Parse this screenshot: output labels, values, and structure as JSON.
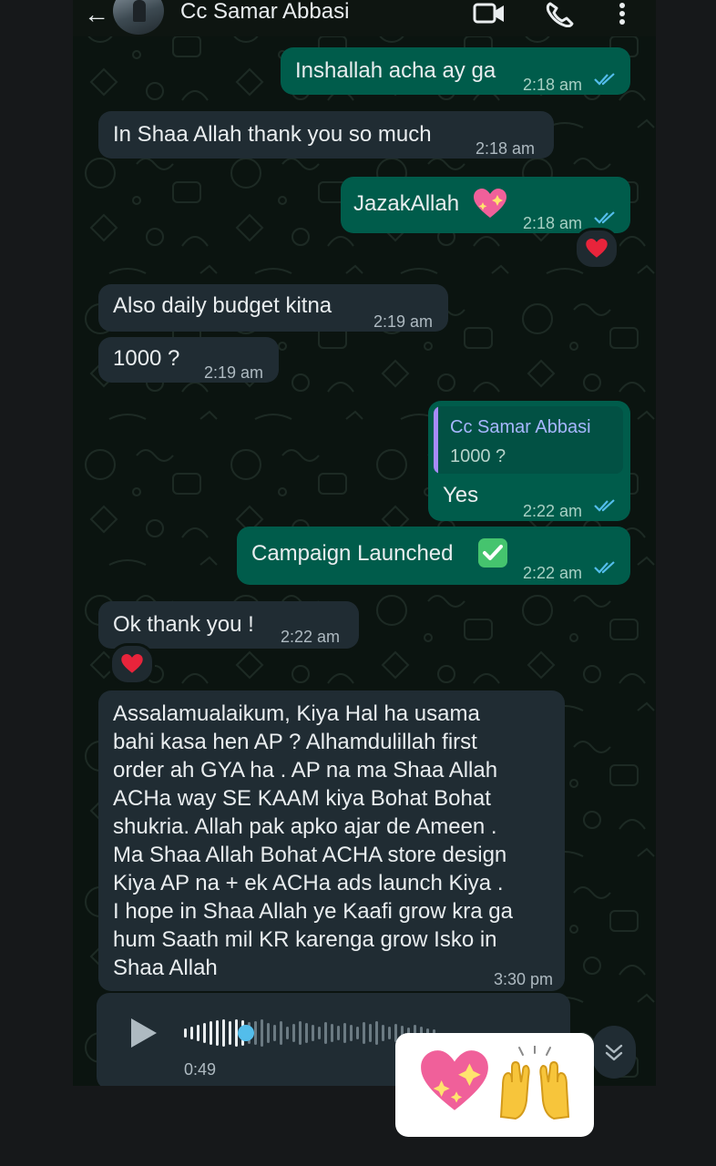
{
  "header": {
    "contact_name": "Cc Samar Abbasi"
  },
  "messages": [
    {
      "text": "Inshallah acha ay ga",
      "time": "2:18 am"
    },
    {
      "text": "In Shaa Allah thank you so much",
      "time": "2:18 am"
    },
    {
      "text": "JazakAllah",
      "time": "2:18 am",
      "emoji": "sparkling-heart-icon",
      "reaction": "red-heart"
    },
    {
      "text": "Also daily budget kitna",
      "time": "2:19 am"
    },
    {
      "text": "1000 ?",
      "time": "2:19 am"
    },
    {
      "quote_name": "Cc Samar Abbasi",
      "quote_text": "1000 ?",
      "text": "Yes",
      "time": "2:22 am"
    },
    {
      "text": "Campaign Launched",
      "time": "2:22 am",
      "emoji": "check-mark-button-icon"
    },
    {
      "text": "Ok thank you !",
      "time": "2:22 am",
      "reaction": "red-heart"
    },
    {
      "lines": [
        "Assalamualaikum, Kiya Hal ha usama",
        "bahi kasa hen AP ? Alhamdulillah first",
        "order ah GYA ha . AP na ma Shaa Allah",
        "ACHa way SE KAAM kiya Bohat Bohat",
        "shukria. Allah pak apko ajar de Ameen .",
        "Ma Shaa Allah Bohat ACHA store design",
        "Kiya AP na + ek ACHa ads launch Kiya .",
        "I hope in Shaa Allah ye Kaafi grow kra ga",
        "hum Saath mil KR karenga grow Isko in",
        "Shaa Allah"
      ],
      "time": "3:30 pm"
    }
  ],
  "voice_note": {
    "duration": "0:49",
    "progress": 0.26
  },
  "sticker_overlay": {
    "emojis": [
      "sparkling-heart-icon",
      "raising-hands-icon"
    ]
  },
  "colors": {
    "outgoing_bubble": "#005c4b",
    "incoming_bubble": "#202c33",
    "read_tick": "#53bdeb",
    "chat_background": "#0b1410"
  }
}
